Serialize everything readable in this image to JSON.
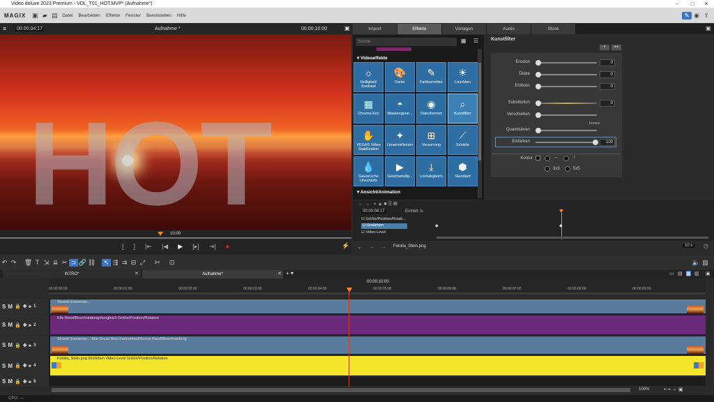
{
  "window": {
    "title": "Video deluxe 2023 Premium - VDL_T01_HOT.MVP* (Aufnahme*)"
  },
  "menubar": {
    "logo": "MAGIX",
    "items": [
      "Datei",
      "Bearbeiten",
      "Effekte",
      "Fenster",
      "Bereitstellen",
      "Hilfe"
    ]
  },
  "monitor": {
    "timecode_left": "00:00:04:17",
    "title": "Aufnahme *",
    "timecode_right": "00:00:10:00",
    "seek_label": "10:00",
    "overlay_text": "HOT"
  },
  "media_tabs": [
    "Import",
    "Effekte",
    "Vorlagen",
    "Audio",
    "Store"
  ],
  "effects": {
    "search_placeholder": "Suche",
    "section_video": "Videoeffekte",
    "section_anim": "Ansicht/Animation",
    "tiles": [
      {
        "label": "Helligkeit/ Kontrast",
        "icon": "☼"
      },
      {
        "label": "Farbe",
        "icon": "🎨"
      },
      {
        "label": "Farbkorrektur",
        "icon": "✎"
      },
      {
        "label": "Leuchten",
        "icon": "☀"
      },
      {
        "label": "Chroma Key",
        "icon": "▦"
      },
      {
        "label": "Maskengene...",
        "icon": "◓"
      },
      {
        "label": "Stanzformen",
        "icon": "◉"
      },
      {
        "label": "Kunstfilter",
        "icon": "⌕"
      },
      {
        "label": "VEGAS Video Stabilization",
        "icon": "✋"
      },
      {
        "label": "Linsenreflexion",
        "icon": "✦"
      },
      {
        "label": "Verzerrung",
        "icon": "⊞"
      },
      {
        "label": "Schärfe",
        "icon": "⟋"
      },
      {
        "label": "Gauss'sche Unschärfe",
        "icon": "💧"
      },
      {
        "label": "Geschwindig...",
        "icon": "▶"
      },
      {
        "label": "Lookabgleich",
        "icon": "⤓"
      },
      {
        "label": "Standard",
        "icon": "⬢"
      }
    ]
  },
  "kunstfilter": {
    "title": "Kunstfilter",
    "rows": [
      {
        "label": "Erosion",
        "value": "0"
      },
      {
        "label": "Dilate",
        "value": "0"
      },
      {
        "label": "Emboss",
        "value": "0"
      },
      {
        "label": "Substitution",
        "value": "0"
      },
      {
        "label": "Verschieben",
        "value": ""
      },
      {
        "label": "Quantisieren",
        "value": ""
      },
      {
        "label": "Einfärben",
        "value": "100"
      }
    ],
    "invers_label": "Invers",
    "kontur_label": "Kontur",
    "size_a": "3x3",
    "size_b": "5x5"
  },
  "keyframes": {
    "timecode": "00:00:04:17",
    "unit_label": "Einheit: ls",
    "params": [
      "Größe/Position/Rotati...",
      "Einfärben",
      "Video-Level"
    ],
    "file": "Fotolia_Stein.png",
    "duration": "10 s"
  },
  "arrangement": {
    "tabs": [
      "INTRO*",
      "Aufnahme*"
    ],
    "ruler_center": "00:00:10:00",
    "ticks": [
      "00:00:00:00",
      "00:00:01:00",
      "00:00:02:00",
      "00:00:03:00",
      "00:00:04:00",
      "00:00:05:00",
      "00:00:06:00",
      "00:00:07:00",
      "00:00:08:00",
      "00:00:09:00"
    ],
    "tracks": [
      {
        "num": "1",
        "clip": "Strand-Sonnenun...",
        "color": "#5a7c9c"
      },
      {
        "num": "2",
        "clip": "Elle  Rand/Beschneidung/Ausgleich  Größe/Position/Rotation",
        "color": "#6c2a7a"
      },
      {
        "num": "3",
        "clip": "Strand-Sonnenun...  Blur  Gross  Blau  Farbverlauf/Sonne  Rand/Beschneidung",
        "color": "#5a7c9c"
      },
      {
        "num": "4",
        "clip": "Fotolia_Stein.png  Einfärben  Video-Level  Größe/Position/Rotation",
        "color": "#f2e52a"
      },
      {
        "num": "5",
        "clip": "",
        "color": "#1d1d1d"
      }
    ],
    "zoom": "100%"
  },
  "status": {
    "cpu": "CPU: —"
  }
}
